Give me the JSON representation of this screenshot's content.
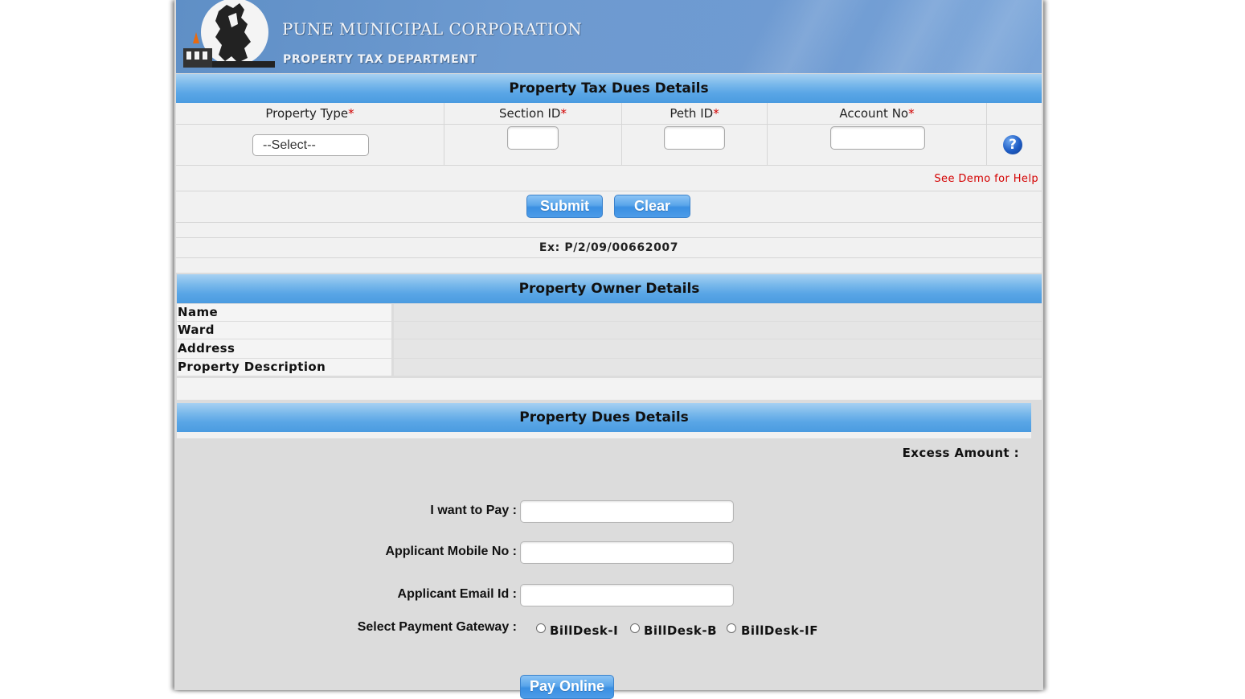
{
  "header": {
    "title": "PUNE MUNICIPAL CORPORATION",
    "subtitle": "PROPERTY TAX DEPARTMENT"
  },
  "dues_form": {
    "heading": "Property Tax Dues Details",
    "columns": [
      "Property Type",
      "Section ID",
      "Peth ID",
      "Account No"
    ],
    "required_mark": "*",
    "property_type_selected": "--Select--",
    "help_icon": "question-help-icon",
    "demo_link": "See Demo for Help",
    "submit_label": "Submit",
    "clear_label": "Clear",
    "example": "Ex: P/2/09/00662007"
  },
  "owner": {
    "heading": "Property Owner Details",
    "rows": [
      "Name",
      "Ward",
      "Address",
      "Property Description"
    ]
  },
  "dues": {
    "heading": "Property Dues Details",
    "excess_label": "Excess Amount :",
    "pay_label": "I want to Pay :",
    "mobile_label": "Applicant Mobile No :",
    "email_label": "Applicant Email Id :",
    "gateway_label": "Select Payment Gateway :",
    "gateways": [
      "BillDesk-I",
      "BillDesk-B",
      "BillDesk-IF"
    ],
    "pay_button": "Pay Online"
  },
  "colors": {
    "header_bar": "#5aa6e6",
    "required": "#d10000",
    "link": "#d40000"
  }
}
